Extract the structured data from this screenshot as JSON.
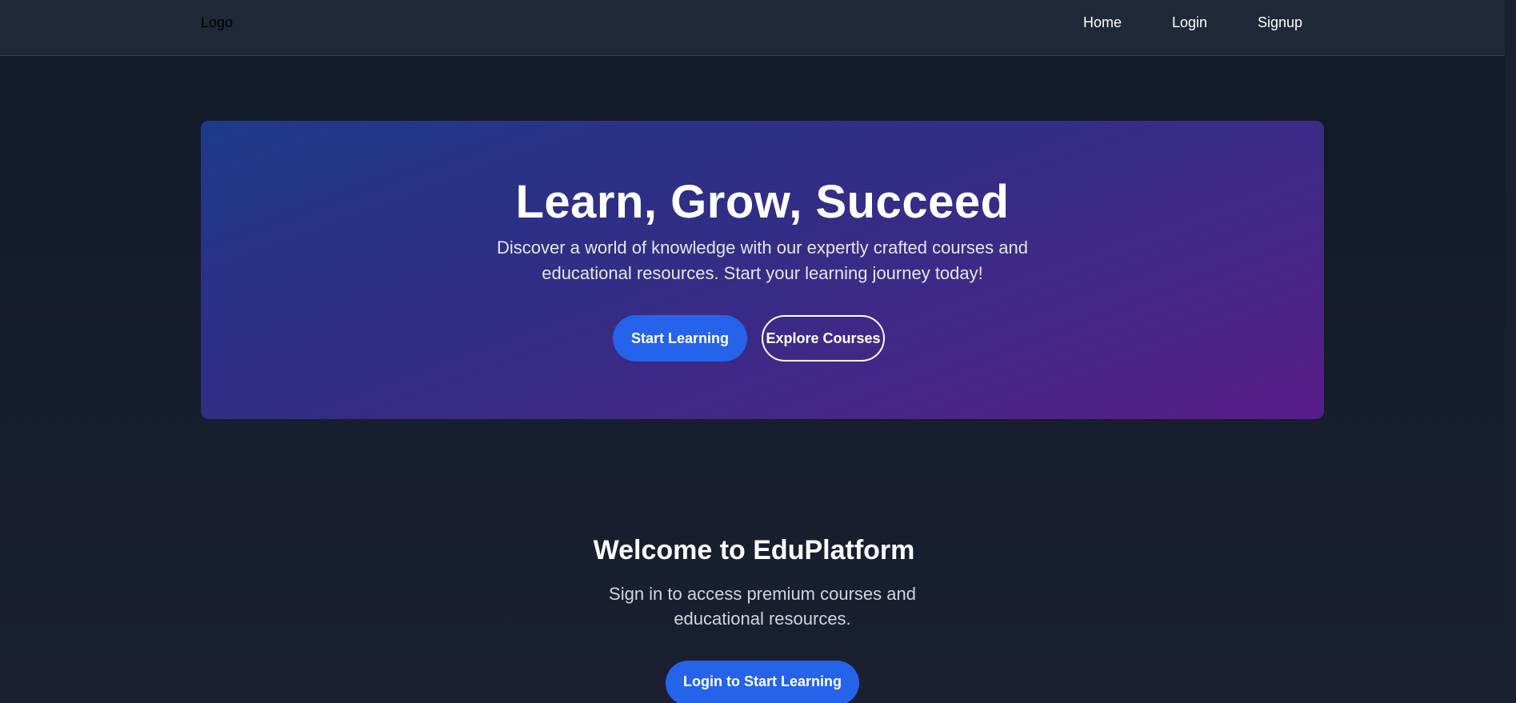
{
  "header": {
    "logo_text": "Logo",
    "nav": {
      "home": "Home",
      "login": "Login",
      "signup": "Signup"
    }
  },
  "hero": {
    "title": "Learn, Grow, Succeed",
    "description": "Discover a world of knowledge with our expertly crafted courses and educational resources. Start your learning journey today!",
    "primary_button": "Start Learning",
    "secondary_button": "Explore Courses"
  },
  "welcome": {
    "title": "Welcome to EduPlatform",
    "description": "Sign in to access premium courses and educational resources.",
    "button": "Login to Start Learning"
  },
  "colors": {
    "background": "#111827",
    "navbar": "#1f2937",
    "accent": "#2563eb",
    "hero_gradient_start": "#1e3a8a",
    "hero_gradient_end": "#571c8a"
  }
}
